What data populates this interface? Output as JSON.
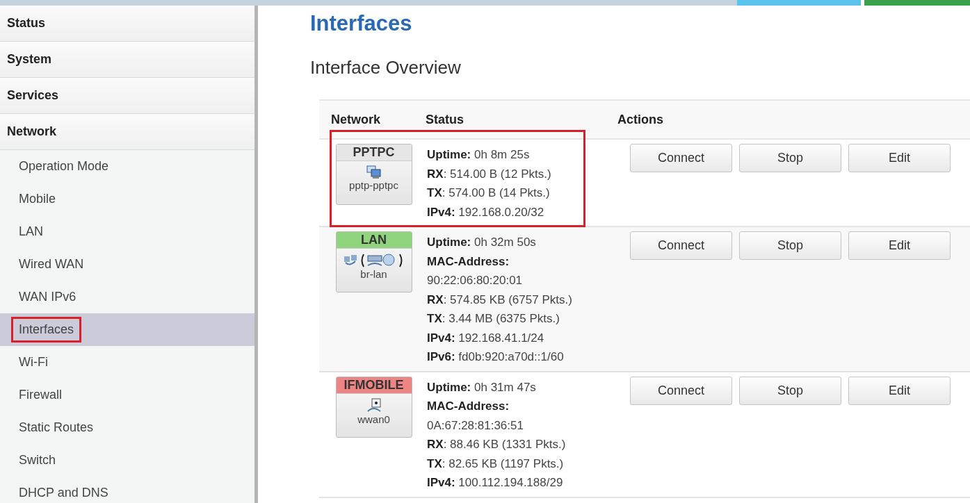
{
  "sidebar": {
    "sections": [
      {
        "label": "Status"
      },
      {
        "label": "System"
      },
      {
        "label": "Services"
      },
      {
        "label": "Network",
        "items": [
          {
            "label": "Operation Mode",
            "selected": false,
            "highlighted": false
          },
          {
            "label": "Mobile",
            "selected": false,
            "highlighted": false
          },
          {
            "label": "LAN",
            "selected": false,
            "highlighted": false
          },
          {
            "label": "Wired WAN",
            "selected": false,
            "highlighted": false
          },
          {
            "label": "WAN IPv6",
            "selected": false,
            "highlighted": false
          },
          {
            "label": "Interfaces",
            "selected": true,
            "highlighted": true
          },
          {
            "label": "Wi-Fi",
            "selected": false,
            "highlighted": false
          },
          {
            "label": "Firewall",
            "selected": false,
            "highlighted": false
          },
          {
            "label": "Static Routes",
            "selected": false,
            "highlighted": false
          },
          {
            "label": "Switch",
            "selected": false,
            "highlighted": false
          },
          {
            "label": "DHCP and DNS",
            "selected": false,
            "highlighted": false
          }
        ]
      }
    ]
  },
  "page": {
    "title": "Interfaces",
    "section_title": "Interface Overview"
  },
  "table": {
    "columns": [
      "Network",
      "Status",
      "Actions"
    ],
    "rows": [
      {
        "name": "PPTPC",
        "device": "pptp-pptpc",
        "kind": "pptp",
        "color": "#e6e6e6",
        "highlighted": true,
        "status": [
          "**Uptime:** 0h 8m 25s",
          "**RX**: 514.00 B (12 Pkts.)",
          "**TX**: 574.00 B (14 Pkts.)",
          "**IPv4:** 192.168.0.20/32"
        ],
        "actions": [
          "Connect",
          "Stop",
          "Edit"
        ]
      },
      {
        "name": "LAN",
        "device": "br-lan",
        "kind": "bridge",
        "color": "#90d47e",
        "highlighted": false,
        "status": [
          "**Uptime:** 0h 32m 50s",
          "**MAC-Address:**",
          "90:22:06:80:20:01",
          "**RX**: 574.85 KB (6757 Pkts.)",
          "**TX**: 3.44 MB (6375 Pkts.)",
          "**IPv4:** 192.168.41.1/24",
          "**IPv6:** fd0b:920:a70d::1/60"
        ],
        "actions": [
          "Connect",
          "Stop",
          "Edit"
        ]
      },
      {
        "name": "IFMOBILE",
        "device": "wwan0",
        "kind": "wwan",
        "color": "#ee8585",
        "highlighted": false,
        "status": [
          "**Uptime:** 0h 31m 47s",
          "**MAC-Address:**",
          "0A:67:28:81:36:51",
          "**RX**: 88.46 KB (1331 Pkts.)",
          "**TX**: 82.65 KB (1197 Pkts.)",
          "**IPv4:** 100.112.194.188/29"
        ],
        "actions": [
          "Connect",
          "Stop",
          "Edit"
        ]
      }
    ]
  }
}
